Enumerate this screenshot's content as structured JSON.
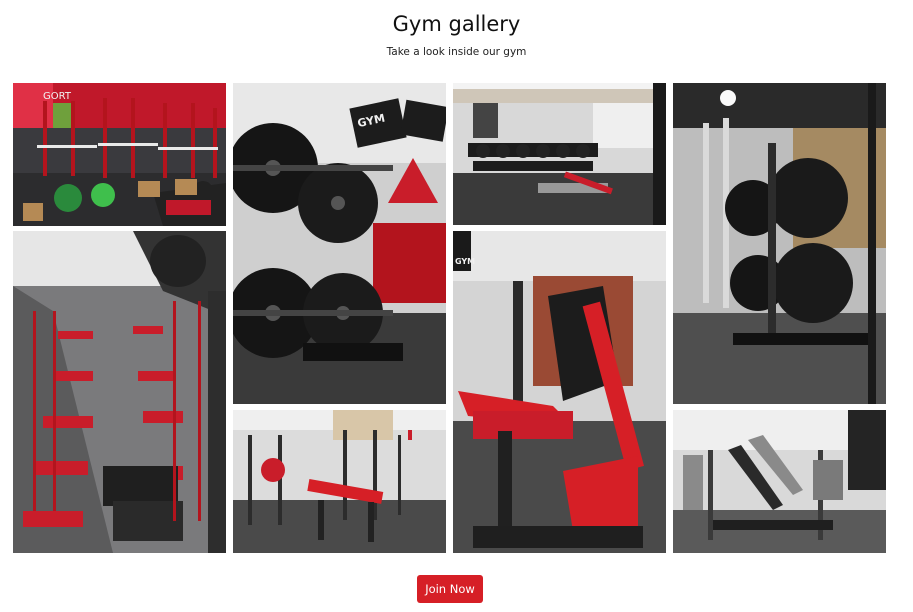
{
  "header": {
    "title": "Gym gallery",
    "subtitle": "Take a look inside our gym"
  },
  "gallery": {
    "photos": [
      {
        "subject": "gym-photo-red-power-racks-overview",
        "sign_text": "GORT"
      },
      {
        "subject": "gym-photo-weight-plates-closeup",
        "sign_text": "GYM"
      },
      {
        "subject": "gym-photo-dumbbell-rack"
      },
      {
        "subject": "gym-photo-plate-tree"
      },
      {
        "subject": "gym-photo-aerial-red-floor"
      },
      {
        "subject": "gym-photo-leg-press-machine",
        "sign_text": "GYM"
      },
      {
        "subject": "gym-photo-adjustable-bench"
      },
      {
        "subject": "gym-photo-plate-loaded-machine"
      }
    ]
  },
  "cta": {
    "label": "Join Now"
  },
  "colors": {
    "accent": "#d61f26"
  }
}
